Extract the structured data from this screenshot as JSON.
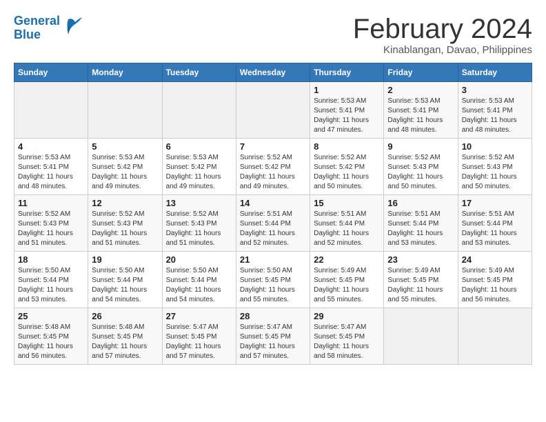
{
  "header": {
    "logo_line1": "General",
    "logo_line2": "Blue",
    "month_title": "February 2024",
    "subtitle": "Kinablangan, Davao, Philippines"
  },
  "weekdays": [
    "Sunday",
    "Monday",
    "Tuesday",
    "Wednesday",
    "Thursday",
    "Friday",
    "Saturday"
  ],
  "weeks": [
    [
      {
        "day": "",
        "sunrise": "",
        "sunset": "",
        "daylight": ""
      },
      {
        "day": "",
        "sunrise": "",
        "sunset": "",
        "daylight": ""
      },
      {
        "day": "",
        "sunrise": "",
        "sunset": "",
        "daylight": ""
      },
      {
        "day": "",
        "sunrise": "",
        "sunset": "",
        "daylight": ""
      },
      {
        "day": "1",
        "sunrise": "Sunrise: 5:53 AM",
        "sunset": "Sunset: 5:41 PM",
        "daylight": "Daylight: 11 hours and 47 minutes."
      },
      {
        "day": "2",
        "sunrise": "Sunrise: 5:53 AM",
        "sunset": "Sunset: 5:41 PM",
        "daylight": "Daylight: 11 hours and 48 minutes."
      },
      {
        "day": "3",
        "sunrise": "Sunrise: 5:53 AM",
        "sunset": "Sunset: 5:41 PM",
        "daylight": "Daylight: 11 hours and 48 minutes."
      }
    ],
    [
      {
        "day": "4",
        "sunrise": "Sunrise: 5:53 AM",
        "sunset": "Sunset: 5:41 PM",
        "daylight": "Daylight: 11 hours and 48 minutes."
      },
      {
        "day": "5",
        "sunrise": "Sunrise: 5:53 AM",
        "sunset": "Sunset: 5:42 PM",
        "daylight": "Daylight: 11 hours and 49 minutes."
      },
      {
        "day": "6",
        "sunrise": "Sunrise: 5:53 AM",
        "sunset": "Sunset: 5:42 PM",
        "daylight": "Daylight: 11 hours and 49 minutes."
      },
      {
        "day": "7",
        "sunrise": "Sunrise: 5:52 AM",
        "sunset": "Sunset: 5:42 PM",
        "daylight": "Daylight: 11 hours and 49 minutes."
      },
      {
        "day": "8",
        "sunrise": "Sunrise: 5:52 AM",
        "sunset": "Sunset: 5:42 PM",
        "daylight": "Daylight: 11 hours and 50 minutes."
      },
      {
        "day": "9",
        "sunrise": "Sunrise: 5:52 AM",
        "sunset": "Sunset: 5:43 PM",
        "daylight": "Daylight: 11 hours and 50 minutes."
      },
      {
        "day": "10",
        "sunrise": "Sunrise: 5:52 AM",
        "sunset": "Sunset: 5:43 PM",
        "daylight": "Daylight: 11 hours and 50 minutes."
      }
    ],
    [
      {
        "day": "11",
        "sunrise": "Sunrise: 5:52 AM",
        "sunset": "Sunset: 5:43 PM",
        "daylight": "Daylight: 11 hours and 51 minutes."
      },
      {
        "day": "12",
        "sunrise": "Sunrise: 5:52 AM",
        "sunset": "Sunset: 5:43 PM",
        "daylight": "Daylight: 11 hours and 51 minutes."
      },
      {
        "day": "13",
        "sunrise": "Sunrise: 5:52 AM",
        "sunset": "Sunset: 5:43 PM",
        "daylight": "Daylight: 11 hours and 51 minutes."
      },
      {
        "day": "14",
        "sunrise": "Sunrise: 5:51 AM",
        "sunset": "Sunset: 5:44 PM",
        "daylight": "Daylight: 11 hours and 52 minutes."
      },
      {
        "day": "15",
        "sunrise": "Sunrise: 5:51 AM",
        "sunset": "Sunset: 5:44 PM",
        "daylight": "Daylight: 11 hours and 52 minutes."
      },
      {
        "day": "16",
        "sunrise": "Sunrise: 5:51 AM",
        "sunset": "Sunset: 5:44 PM",
        "daylight": "Daylight: 11 hours and 53 minutes."
      },
      {
        "day": "17",
        "sunrise": "Sunrise: 5:51 AM",
        "sunset": "Sunset: 5:44 PM",
        "daylight": "Daylight: 11 hours and 53 minutes."
      }
    ],
    [
      {
        "day": "18",
        "sunrise": "Sunrise: 5:50 AM",
        "sunset": "Sunset: 5:44 PM",
        "daylight": "Daylight: 11 hours and 53 minutes."
      },
      {
        "day": "19",
        "sunrise": "Sunrise: 5:50 AM",
        "sunset": "Sunset: 5:44 PM",
        "daylight": "Daylight: 11 hours and 54 minutes."
      },
      {
        "day": "20",
        "sunrise": "Sunrise: 5:50 AM",
        "sunset": "Sunset: 5:44 PM",
        "daylight": "Daylight: 11 hours and 54 minutes."
      },
      {
        "day": "21",
        "sunrise": "Sunrise: 5:50 AM",
        "sunset": "Sunset: 5:45 PM",
        "daylight": "Daylight: 11 hours and 55 minutes."
      },
      {
        "day": "22",
        "sunrise": "Sunrise: 5:49 AM",
        "sunset": "Sunset: 5:45 PM",
        "daylight": "Daylight: 11 hours and 55 minutes."
      },
      {
        "day": "23",
        "sunrise": "Sunrise: 5:49 AM",
        "sunset": "Sunset: 5:45 PM",
        "daylight": "Daylight: 11 hours and 55 minutes."
      },
      {
        "day": "24",
        "sunrise": "Sunrise: 5:49 AM",
        "sunset": "Sunset: 5:45 PM",
        "daylight": "Daylight: 11 hours and 56 minutes."
      }
    ],
    [
      {
        "day": "25",
        "sunrise": "Sunrise: 5:48 AM",
        "sunset": "Sunset: 5:45 PM",
        "daylight": "Daylight: 11 hours and 56 minutes."
      },
      {
        "day": "26",
        "sunrise": "Sunrise: 5:48 AM",
        "sunset": "Sunset: 5:45 PM",
        "daylight": "Daylight: 11 hours and 57 minutes."
      },
      {
        "day": "27",
        "sunrise": "Sunrise: 5:47 AM",
        "sunset": "Sunset: 5:45 PM",
        "daylight": "Daylight: 11 hours and 57 minutes."
      },
      {
        "day": "28",
        "sunrise": "Sunrise: 5:47 AM",
        "sunset": "Sunset: 5:45 PM",
        "daylight": "Daylight: 11 hours and 57 minutes."
      },
      {
        "day": "29",
        "sunrise": "Sunrise: 5:47 AM",
        "sunset": "Sunset: 5:45 PM",
        "daylight": "Daylight: 11 hours and 58 minutes."
      },
      {
        "day": "",
        "sunrise": "",
        "sunset": "",
        "daylight": ""
      },
      {
        "day": "",
        "sunrise": "",
        "sunset": "",
        "daylight": ""
      }
    ]
  ]
}
